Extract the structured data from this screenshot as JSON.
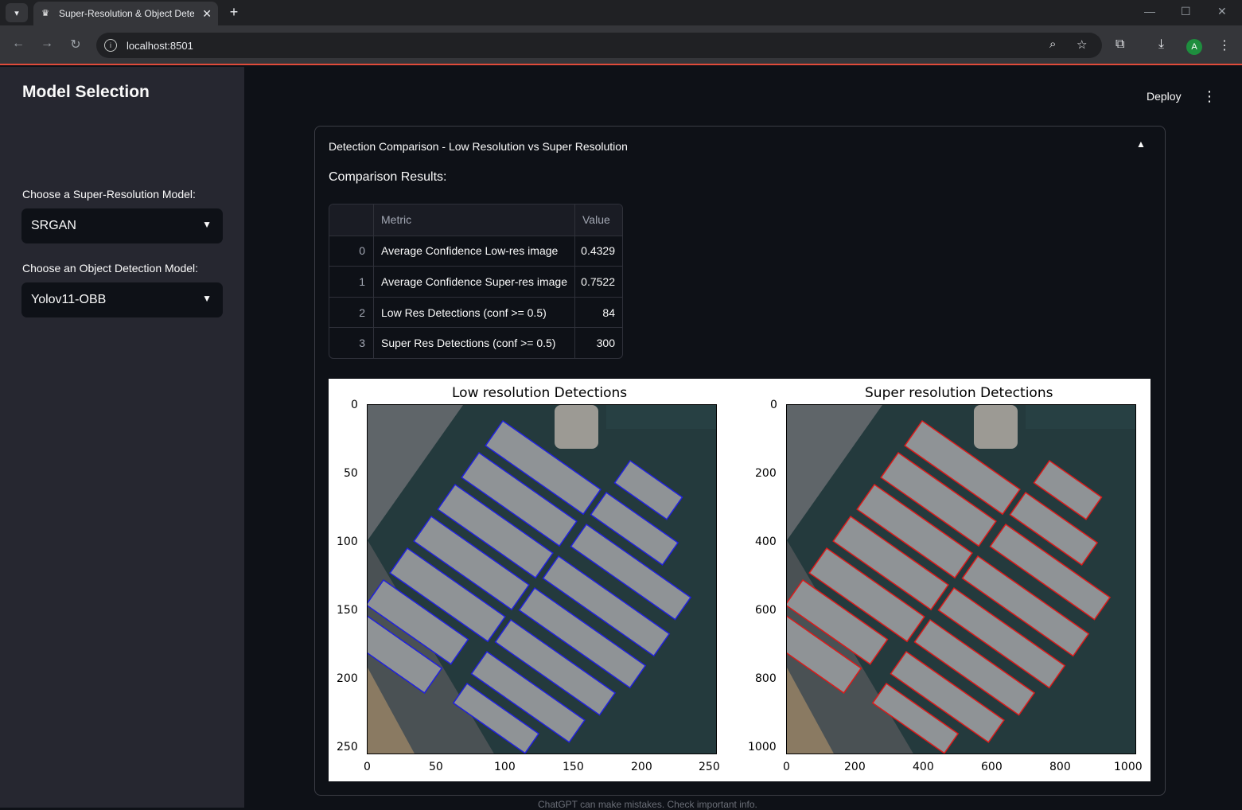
{
  "browser": {
    "tab_title": "Super-Resolution & Object Detection",
    "url": "localhost:8501",
    "avatar_letter": "A"
  },
  "header": {
    "deploy_label": "Deploy"
  },
  "sidebar": {
    "title": "Model Selection",
    "sr_label": "Choose a Super-Resolution Model:",
    "sr_value": "SRGAN",
    "od_label": "Choose an Object Detection Model:",
    "od_value": "Yolov11-OBB"
  },
  "expander": {
    "title": "Detection Comparison - Low Resolution vs Super Resolution",
    "results_title": "Comparison Results:"
  },
  "table": {
    "headers": [
      "",
      "Metric",
      "Value"
    ],
    "rows": [
      {
        "idx": "0",
        "metric": "Average Confidence Low-res image",
        "value": "0.4329"
      },
      {
        "idx": "1",
        "metric": "Average Confidence Super-res image",
        "value": "0.7522"
      },
      {
        "idx": "2",
        "metric": "Low Res Detections (conf >= 0.5)",
        "value": "84"
      },
      {
        "idx": "3",
        "metric": "Super Res Detections (conf >= 0.5)",
        "value": "300"
      }
    ]
  },
  "figure": {
    "left": {
      "title": "Low resolution Detections",
      "yticks": [
        "0",
        "50",
        "100",
        "150",
        "200",
        "250"
      ],
      "xticks": [
        "0",
        "50",
        "100",
        "150",
        "200",
        "250"
      ],
      "box_color": "#2020dd"
    },
    "right": {
      "title": "Super resolution Detections",
      "yticks": [
        "0",
        "200",
        "400",
        "600",
        "800",
        "1000"
      ],
      "xticks": [
        "0",
        "200",
        "400",
        "600",
        "800",
        "1000"
      ],
      "box_color": "#dd1a1a"
    }
  },
  "footer_note": "ChatGPT can make mistakes. Check important info."
}
